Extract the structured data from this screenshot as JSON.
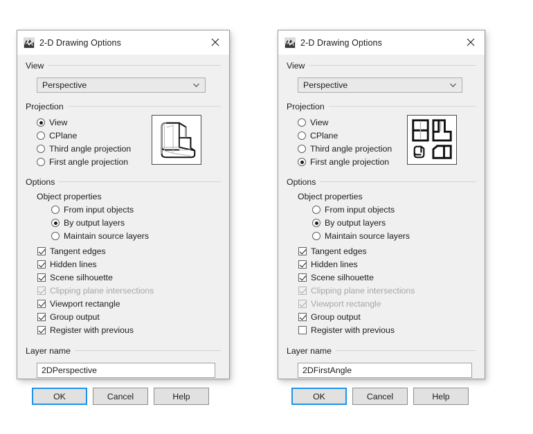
{
  "dialogs": [
    {
      "id": "left",
      "titlebar": {
        "icon": "rhino-app-icon",
        "title": "2-D Drawing Options",
        "close": "close-icon"
      },
      "view": {
        "group_label": "View",
        "combo": {
          "value": "Perspective",
          "arrow_icon": "chevron-down-icon"
        }
      },
      "projection": {
        "group_label": "Projection",
        "preview_icon": "perspective-preview",
        "options": [
          {
            "label": "View",
            "selected": true
          },
          {
            "label": "CPlane",
            "selected": false
          },
          {
            "label": "Third angle projection",
            "selected": false
          },
          {
            "label": "First angle projection",
            "selected": false
          }
        ]
      },
      "options": {
        "group_label": "Options",
        "object_properties_label": "Object properties",
        "object_properties": [
          {
            "label": "From input objects",
            "selected": false
          },
          {
            "label": "By output layers",
            "selected": true
          },
          {
            "label": "Maintain source layers",
            "selected": false
          }
        ],
        "checkboxes": [
          {
            "label": "Tangent edges",
            "checked": true,
            "disabled": false
          },
          {
            "label": "Hidden lines",
            "checked": true,
            "disabled": false
          },
          {
            "label": "Scene silhouette",
            "checked": true,
            "disabled": false
          },
          {
            "label": "Clipping plane intersections",
            "checked": true,
            "disabled": true
          },
          {
            "label": "Viewport rectangle",
            "checked": true,
            "disabled": false
          },
          {
            "label": "Group output",
            "checked": true,
            "disabled": false
          },
          {
            "label": "Register with previous",
            "checked": true,
            "disabled": false
          }
        ]
      },
      "layer": {
        "group_label": "Layer name",
        "value": "2DPerspective",
        "placeholder": ""
      },
      "buttons": [
        {
          "label": "OK",
          "default": true
        },
        {
          "label": "Cancel",
          "default": false
        },
        {
          "label": "Help",
          "default": false
        }
      ]
    },
    {
      "id": "right",
      "titlebar": {
        "icon": "rhino-app-icon",
        "title": "2-D Drawing Options",
        "close": "close-icon"
      },
      "view": {
        "group_label": "View",
        "combo": {
          "value": "Perspective",
          "arrow_icon": "chevron-down-icon"
        }
      },
      "projection": {
        "group_label": "Projection",
        "preview_icon": "first-angle-preview",
        "options": [
          {
            "label": "View",
            "selected": false
          },
          {
            "label": "CPlane",
            "selected": false
          },
          {
            "label": "Third angle projection",
            "selected": false
          },
          {
            "label": "First angle projection",
            "selected": true
          }
        ]
      },
      "options": {
        "group_label": "Options",
        "object_properties_label": "Object properties",
        "object_properties": [
          {
            "label": "From input objects",
            "selected": false
          },
          {
            "label": "By output layers",
            "selected": true
          },
          {
            "label": "Maintain source layers",
            "selected": false
          }
        ],
        "checkboxes": [
          {
            "label": "Tangent edges",
            "checked": true,
            "disabled": false
          },
          {
            "label": "Hidden lines",
            "checked": true,
            "disabled": false
          },
          {
            "label": "Scene silhouette",
            "checked": true,
            "disabled": false
          },
          {
            "label": "Clipping plane intersections",
            "checked": true,
            "disabled": true
          },
          {
            "label": "Viewport rectangle",
            "checked": true,
            "disabled": true
          },
          {
            "label": "Group output",
            "checked": true,
            "disabled": false
          },
          {
            "label": "Register with previous",
            "checked": false,
            "disabled": false
          }
        ]
      },
      "layer": {
        "group_label": "Layer name",
        "value": "2DFirstAngle",
        "placeholder": ""
      },
      "buttons": [
        {
          "label": "OK",
          "default": true
        },
        {
          "label": "Cancel",
          "default": false
        },
        {
          "label": "Help",
          "default": false
        }
      ]
    }
  ],
  "colors": {
    "dialog_face": "#f0f0f0",
    "titlebar": "#ffffff",
    "accent_focus": "#1e93e8",
    "text": "#1b1b1b",
    "disabled_text": "#a6a6a6",
    "border": "#9a9a9a"
  }
}
